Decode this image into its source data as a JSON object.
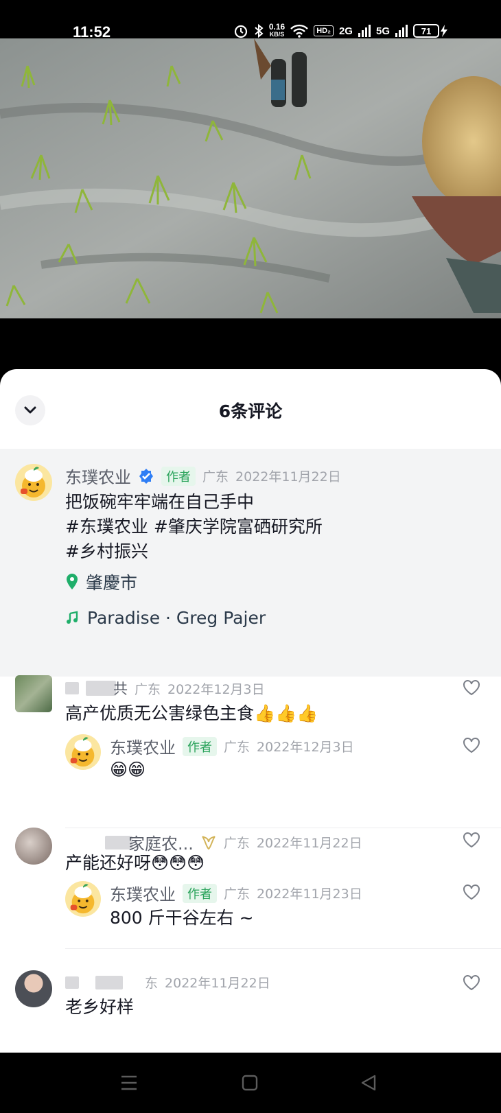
{
  "status_bar": {
    "time": "11:52",
    "speed_value": "0.16",
    "speed_unit": "KB/S",
    "hd": "HD₂",
    "net1": "2G",
    "net2": "5G",
    "battery": "71"
  },
  "sheet": {
    "title": "6条评论"
  },
  "post": {
    "author": "东璞农业",
    "author_tag": "作者",
    "region": "广东",
    "date": "2022年11月22日",
    "text_line1": "把饭碗牢牢端在自己手中",
    "text_line2": "#东璞农业 #肇庆学院富硒研究所",
    "text_line3": "#乡村振兴",
    "location": "肇慶市",
    "music": "Paradise · Greg Pajer"
  },
  "comments": [
    {
      "user_visible": "共",
      "region": "广东",
      "date": "2022年12月3日",
      "text": "高产优质无公害绿色主食👍👍👍",
      "reply": {
        "author": "东璞农业",
        "author_tag": "作者",
        "region": "广东",
        "date": "2022年12月3日",
        "text": "😁😁"
      }
    },
    {
      "user_visible": "家庭农...",
      "region": "广东",
      "date": "2022年11月22日",
      "text": "产能还好呀😳😳😳",
      "reply": {
        "author": "东璞农业",
        "author_tag": "作者",
        "region": "广东",
        "date": "2022年11月23日",
        "text": "800 斤干谷左右 ~"
      }
    },
    {
      "user_visible": "",
      "region": "东",
      "date": "2022年11月22日",
      "text": "老乡好样"
    }
  ]
}
